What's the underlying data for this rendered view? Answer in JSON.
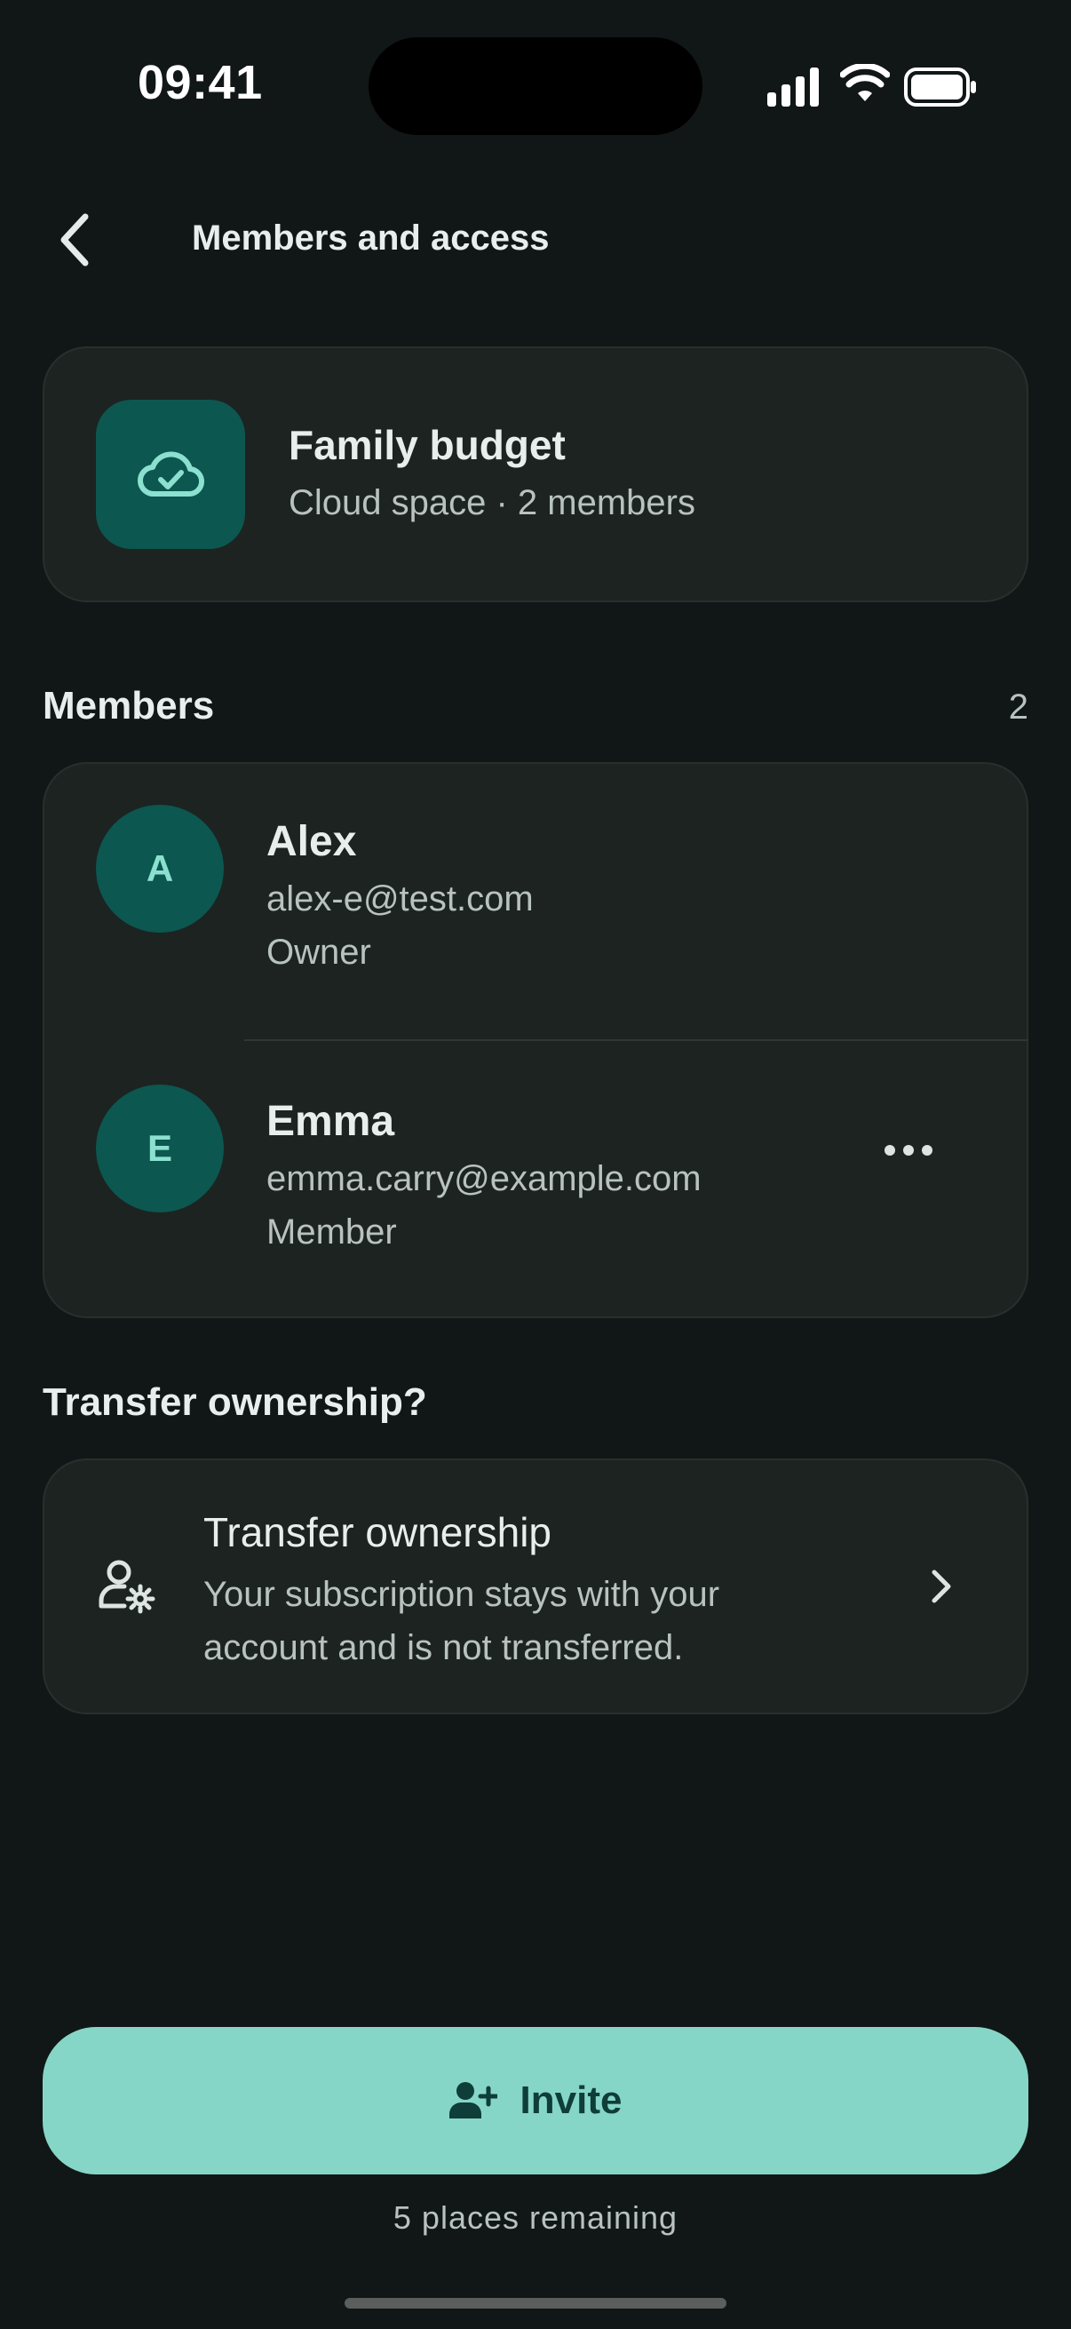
{
  "status_bar": {
    "time": "09:41"
  },
  "header": {
    "title": "Members and access"
  },
  "space": {
    "name": "Family budget",
    "subtitle": "Cloud space · 2 members",
    "icon": "cloud-check-icon"
  },
  "members_section": {
    "heading": "Members",
    "count": "2",
    "members": [
      {
        "initial": "A",
        "name": "Alex",
        "email": "alex-e@test.com",
        "role": "Owner"
      },
      {
        "initial": "E",
        "name": "Emma",
        "email": "emma.carry@example.com",
        "role": "Member"
      }
    ]
  },
  "transfer_section": {
    "heading": "Transfer ownership?",
    "title": "Transfer ownership",
    "description": "Your subscription stays with your account and is not transferred.",
    "icon": "user-settings-icon"
  },
  "invite": {
    "label": "Invite",
    "icon": "add-user-icon",
    "remaining": "5 places remaining"
  },
  "colors": {
    "background": "#111716",
    "card": "#1c2321",
    "accent": "#86d6c8",
    "avatar": "#0c5750"
  }
}
